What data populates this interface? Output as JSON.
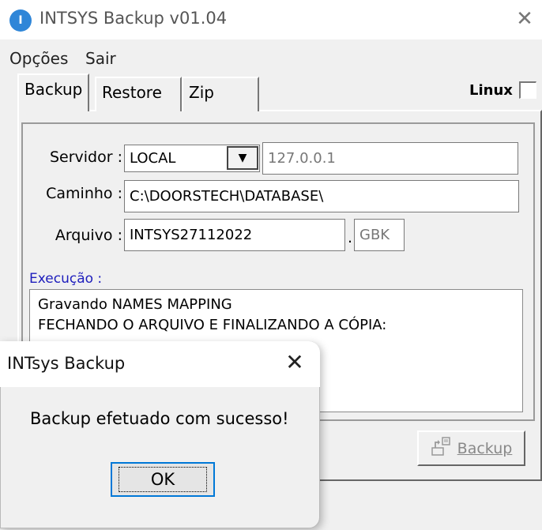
{
  "window": {
    "title": "INTSYS Backup v01.04",
    "icon_letter": "I",
    "close_glyph": "✕"
  },
  "menu": {
    "items": [
      "Opções",
      "Sair"
    ]
  },
  "tabs": [
    "Backup",
    "Restore",
    "Zip"
  ],
  "linux": {
    "label": "Linux",
    "checked": false
  },
  "form": {
    "servidor_label": "Servidor :",
    "servidor_value": "LOCAL",
    "servidor_ip": "127.0.0.1",
    "caminho_label": "Caminho :",
    "caminho_value": "C:\\DOORSTECH\\DATABASE\\",
    "arquivo_label": "Arquivo :",
    "arquivo_value": "INTSYS27112022",
    "arquivo_dot": ".",
    "arquivo_ext": "GBK"
  },
  "execucao": {
    "label": "Execução :",
    "lines": [
      "Gravando NAMES MAPPING",
      "FECHANDO O ARQUIVO E FINALIZANDO A CÓPIA:"
    ]
  },
  "backup_button": {
    "label": "Backup"
  },
  "dialog": {
    "title": "INTsys Backup",
    "close_glyph": "✕",
    "message": "Backup efetuado com sucesso!",
    "ok_label": "OK"
  }
}
